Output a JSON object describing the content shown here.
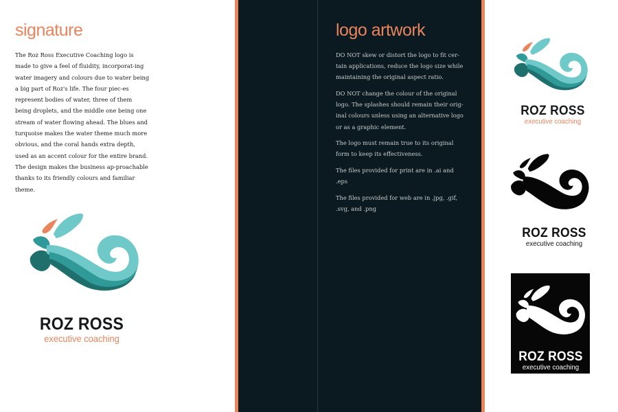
{
  "signature": {
    "heading": "signature",
    "paragraph": "The Roz Ross Executive Coaching logo is made to give a feel of fluidity, incorporat-ing water imagery and colours due to water being a big part of Roz's life. The four piec-es represent bodies of water, three of them being droplets, and the middle one being one stream of water flowing ahead. The blues and turquoise makes the water theme much more obvious, and the coral hands extra depth, used as an accent colour for the entire brand. The design makes the business ap-proachable thanks to its friendly colours and familiar theme."
  },
  "logo_artwork": {
    "heading": "logo artwork",
    "rules": [
      "DO NOT skew or distort the logo to fit cer-tain applications, reduce the logo size while maintaining the original aspect ratio.",
      "DO NOT change the colour of the original logo. The splashes should remain their orig-inal colours unless using an alternative logo or as a graphic element.",
      "The logo must remain true to its original form to keep its effectiveness.",
      "The files provided for print are in .ai and .eps",
      "The files provided for web are in .jpg, .gif, .svg, and .png"
    ]
  },
  "brand": {
    "name": "ROZ ROSS",
    "tagline": "executive coaching"
  },
  "colors": {
    "coral": "#e9845c",
    "turquoise_light": "#6fc9c8",
    "teal_mid": "#2f9a97",
    "teal_dark": "#1f6f6d",
    "dark_panel": "#0b1a20"
  },
  "logo_variants": [
    "full-colour",
    "black",
    "white-on-black"
  ]
}
